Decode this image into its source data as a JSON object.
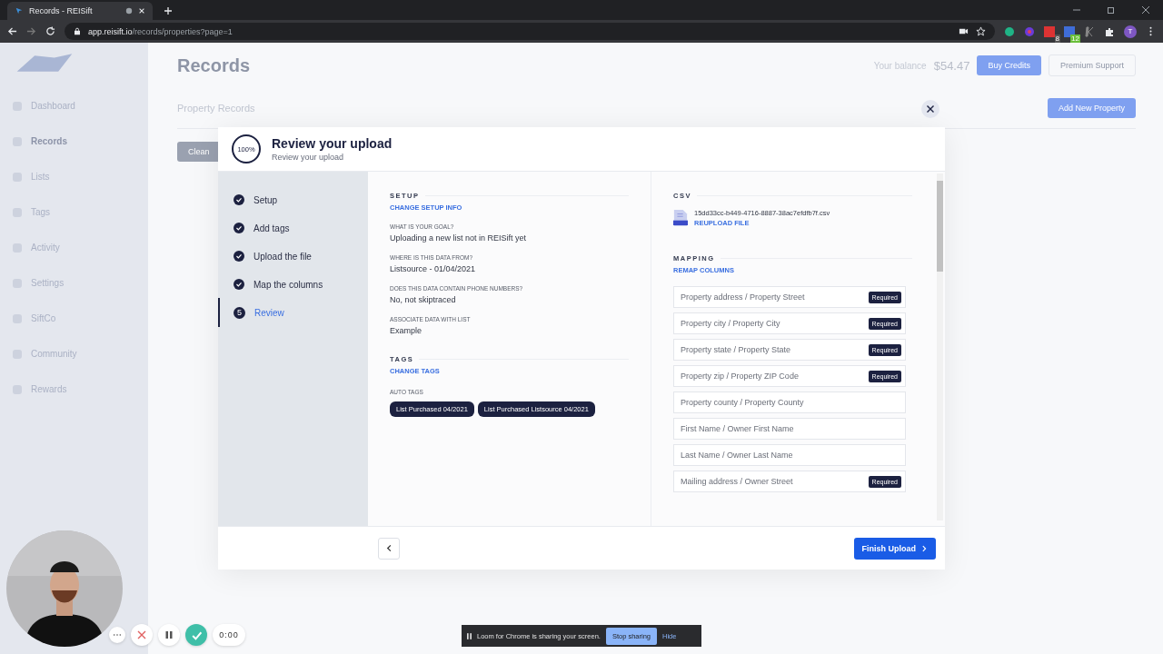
{
  "browser": {
    "tab_title": "Records - REISift",
    "url_host": "app.reisift.io",
    "url_path": "/records/properties?page=1",
    "extension_badges": [
      "8",
      "12"
    ],
    "profile_initial": "T"
  },
  "app": {
    "sidebar_items": [
      {
        "label": "Dashboard",
        "selected": false
      },
      {
        "label": "Records",
        "selected": true
      },
      {
        "label": "Lists",
        "selected": false
      },
      {
        "label": "Tags",
        "selected": false
      },
      {
        "label": "Activity",
        "selected": false
      },
      {
        "label": "Settings",
        "selected": false
      },
      {
        "label": "SiftCo",
        "selected": false
      },
      {
        "label": "Community",
        "selected": false
      },
      {
        "label": "Rewards",
        "selected": false
      }
    ],
    "page_title": "Records",
    "balance_label": "Your balance",
    "balance": "$54.47",
    "buy_button": "Buy Credits",
    "support_button": "Premium Support",
    "tab": "Property Records",
    "add_button": "Add New Property",
    "clean_button": "Clean"
  },
  "modal": {
    "progress": "100%",
    "title": "Review your upload",
    "subtitle": "Review your upload",
    "steps": [
      {
        "label": "Setup",
        "completed": true,
        "selected": false
      },
      {
        "label": "Add tags",
        "completed": true,
        "selected": false
      },
      {
        "label": "Upload the file",
        "completed": true,
        "selected": false
      },
      {
        "label": "Map the columns",
        "completed": true,
        "selected": false
      },
      {
        "label": "Review",
        "completed": false,
        "selected": true,
        "number": "5"
      }
    ],
    "setup": {
      "heading": "SETUP",
      "link": "CHANGE SETUP INFO",
      "fields": [
        {
          "label": "WHAT IS YOUR GOAL?",
          "value": "Uploading a new list not in REISift yet"
        },
        {
          "label": "WHERE IS THIS DATA FROM?",
          "value": "Listsource - 01/04/2021"
        },
        {
          "label": "DOES THIS DATA CONTAIN PHONE NUMBERS?",
          "value": "No, not skiptraced"
        },
        {
          "label": "ASSOCIATE DATA WITH LIST",
          "value": "Example"
        }
      ]
    },
    "tags": {
      "heading": "TAGS",
      "link": "CHANGE TAGS",
      "auto_label": "AUTO TAGS",
      "items": [
        "List Purchased 04/2021",
        "List Purchased Listsource 04/2021"
      ]
    },
    "csv": {
      "heading": "CSV",
      "filename": "15dd33cc-b449-4716-8887-38ac7efdfb7f.csv",
      "link": "REUPLOAD FILE"
    },
    "mapping": {
      "heading": "MAPPING",
      "link": "REMAP COLUMNS",
      "rows": [
        {
          "label": "Property address / Property Street",
          "badge": "Required"
        },
        {
          "label": "Property city / Property City",
          "badge": "Required"
        },
        {
          "label": "Property state / Property State",
          "badge": "Required"
        },
        {
          "label": "Property zip / Property ZIP Code",
          "badge": "Required"
        },
        {
          "label": "Property county / Property County"
        },
        {
          "label": "First Name / Owner First Name"
        },
        {
          "label": "Last Name / Owner Last Name"
        },
        {
          "label": "Mailing address / Owner Street",
          "badge": "Required"
        }
      ]
    },
    "finish_button": "Finish Upload"
  },
  "loom": {
    "timer": "0:00",
    "notice": "Loom for Chrome is sharing your screen.",
    "stop_button": "Stop sharing",
    "hide_link": "Hide"
  }
}
